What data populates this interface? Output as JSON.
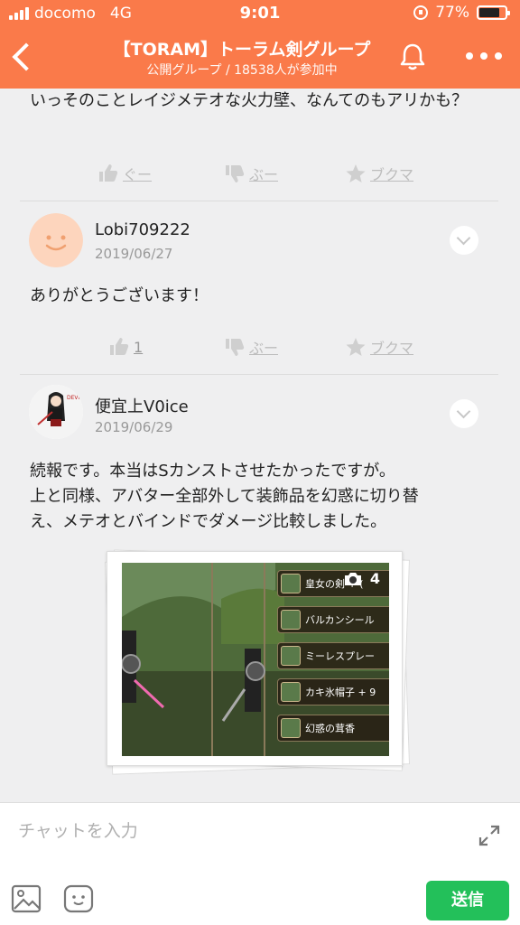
{
  "status": {
    "carrier": "docomo",
    "network": "4G",
    "time": "9:01",
    "battery": "77%",
    "battery_level": 0.77
  },
  "header": {
    "back_icon": "chevron-left-icon",
    "title": "【TORAM】トーラム剣グループ",
    "subtitle": "公開グループ / 18538人が参加中",
    "bell_icon": "bell-icon",
    "more_icon": "more-dots-icon"
  },
  "posts": [
    {
      "text": "いっそのことレイジメテオな火力壁、なんてのもアリかも？",
      "actions": {
        "good": "ぐー",
        "boo": "ぶー",
        "bookmark": "ブクマ"
      }
    },
    {
      "user": "Lobi709222",
      "date": "2019/06/27",
      "text": "ありがとうございます！",
      "actions": {
        "good": "1",
        "boo": "ぶー",
        "bookmark": "ブクマ"
      }
    },
    {
      "user": "便宜上V0ice",
      "date": "2019/06/29",
      "text_lines": [
        "続報です。本当はSカンストさせたかったですが。",
        "上と同様、アバター全部外して装飾品を幻惑に切り替",
        "え、メテオとバインドでダメージ比較しました。"
      ],
      "photo_count": "4",
      "skills": [
        "皇女の剣 + (",
        "バルカンシール",
        "ミーレスプレー",
        "カキ氷帽子 + 9",
        "幻惑の茸香"
      ]
    }
  ],
  "composer": {
    "placeholder": "チャットを入力",
    "send_label": "送信"
  },
  "colors": {
    "accent": "#fa7a4a",
    "send": "#23c05a"
  }
}
